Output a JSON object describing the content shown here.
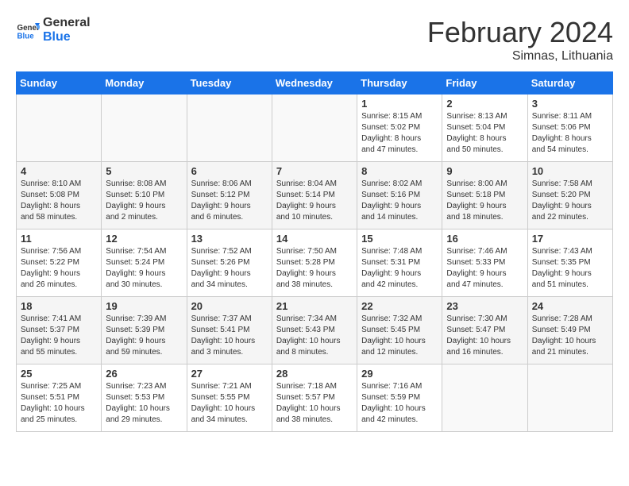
{
  "header": {
    "logo_line1": "General",
    "logo_line2": "Blue",
    "month": "February 2024",
    "location": "Simnas, Lithuania"
  },
  "weekdays": [
    "Sunday",
    "Monday",
    "Tuesday",
    "Wednesday",
    "Thursday",
    "Friday",
    "Saturday"
  ],
  "weeks": [
    [
      {
        "day": "",
        "info": ""
      },
      {
        "day": "",
        "info": ""
      },
      {
        "day": "",
        "info": ""
      },
      {
        "day": "",
        "info": ""
      },
      {
        "day": "1",
        "info": "Sunrise: 8:15 AM\nSunset: 5:02 PM\nDaylight: 8 hours\nand 47 minutes."
      },
      {
        "day": "2",
        "info": "Sunrise: 8:13 AM\nSunset: 5:04 PM\nDaylight: 8 hours\nand 50 minutes."
      },
      {
        "day": "3",
        "info": "Sunrise: 8:11 AM\nSunset: 5:06 PM\nDaylight: 8 hours\nand 54 minutes."
      }
    ],
    [
      {
        "day": "4",
        "info": "Sunrise: 8:10 AM\nSunset: 5:08 PM\nDaylight: 8 hours\nand 58 minutes."
      },
      {
        "day": "5",
        "info": "Sunrise: 8:08 AM\nSunset: 5:10 PM\nDaylight: 9 hours\nand 2 minutes."
      },
      {
        "day": "6",
        "info": "Sunrise: 8:06 AM\nSunset: 5:12 PM\nDaylight: 9 hours\nand 6 minutes."
      },
      {
        "day": "7",
        "info": "Sunrise: 8:04 AM\nSunset: 5:14 PM\nDaylight: 9 hours\nand 10 minutes."
      },
      {
        "day": "8",
        "info": "Sunrise: 8:02 AM\nSunset: 5:16 PM\nDaylight: 9 hours\nand 14 minutes."
      },
      {
        "day": "9",
        "info": "Sunrise: 8:00 AM\nSunset: 5:18 PM\nDaylight: 9 hours\nand 18 minutes."
      },
      {
        "day": "10",
        "info": "Sunrise: 7:58 AM\nSunset: 5:20 PM\nDaylight: 9 hours\nand 22 minutes."
      }
    ],
    [
      {
        "day": "11",
        "info": "Sunrise: 7:56 AM\nSunset: 5:22 PM\nDaylight: 9 hours\nand 26 minutes."
      },
      {
        "day": "12",
        "info": "Sunrise: 7:54 AM\nSunset: 5:24 PM\nDaylight: 9 hours\nand 30 minutes."
      },
      {
        "day": "13",
        "info": "Sunrise: 7:52 AM\nSunset: 5:26 PM\nDaylight: 9 hours\nand 34 minutes."
      },
      {
        "day": "14",
        "info": "Sunrise: 7:50 AM\nSunset: 5:28 PM\nDaylight: 9 hours\nand 38 minutes."
      },
      {
        "day": "15",
        "info": "Sunrise: 7:48 AM\nSunset: 5:31 PM\nDaylight: 9 hours\nand 42 minutes."
      },
      {
        "day": "16",
        "info": "Sunrise: 7:46 AM\nSunset: 5:33 PM\nDaylight: 9 hours\nand 47 minutes."
      },
      {
        "day": "17",
        "info": "Sunrise: 7:43 AM\nSunset: 5:35 PM\nDaylight: 9 hours\nand 51 minutes."
      }
    ],
    [
      {
        "day": "18",
        "info": "Sunrise: 7:41 AM\nSunset: 5:37 PM\nDaylight: 9 hours\nand 55 minutes."
      },
      {
        "day": "19",
        "info": "Sunrise: 7:39 AM\nSunset: 5:39 PM\nDaylight: 9 hours\nand 59 minutes."
      },
      {
        "day": "20",
        "info": "Sunrise: 7:37 AM\nSunset: 5:41 PM\nDaylight: 10 hours\nand 3 minutes."
      },
      {
        "day": "21",
        "info": "Sunrise: 7:34 AM\nSunset: 5:43 PM\nDaylight: 10 hours\nand 8 minutes."
      },
      {
        "day": "22",
        "info": "Sunrise: 7:32 AM\nSunset: 5:45 PM\nDaylight: 10 hours\nand 12 minutes."
      },
      {
        "day": "23",
        "info": "Sunrise: 7:30 AM\nSunset: 5:47 PM\nDaylight: 10 hours\nand 16 minutes."
      },
      {
        "day": "24",
        "info": "Sunrise: 7:28 AM\nSunset: 5:49 PM\nDaylight: 10 hours\nand 21 minutes."
      }
    ],
    [
      {
        "day": "25",
        "info": "Sunrise: 7:25 AM\nSunset: 5:51 PM\nDaylight: 10 hours\nand 25 minutes."
      },
      {
        "day": "26",
        "info": "Sunrise: 7:23 AM\nSunset: 5:53 PM\nDaylight: 10 hours\nand 29 minutes."
      },
      {
        "day": "27",
        "info": "Sunrise: 7:21 AM\nSunset: 5:55 PM\nDaylight: 10 hours\nand 34 minutes."
      },
      {
        "day": "28",
        "info": "Sunrise: 7:18 AM\nSunset: 5:57 PM\nDaylight: 10 hours\nand 38 minutes."
      },
      {
        "day": "29",
        "info": "Sunrise: 7:16 AM\nSunset: 5:59 PM\nDaylight: 10 hours\nand 42 minutes."
      },
      {
        "day": "",
        "info": ""
      },
      {
        "day": "",
        "info": ""
      }
    ]
  ]
}
